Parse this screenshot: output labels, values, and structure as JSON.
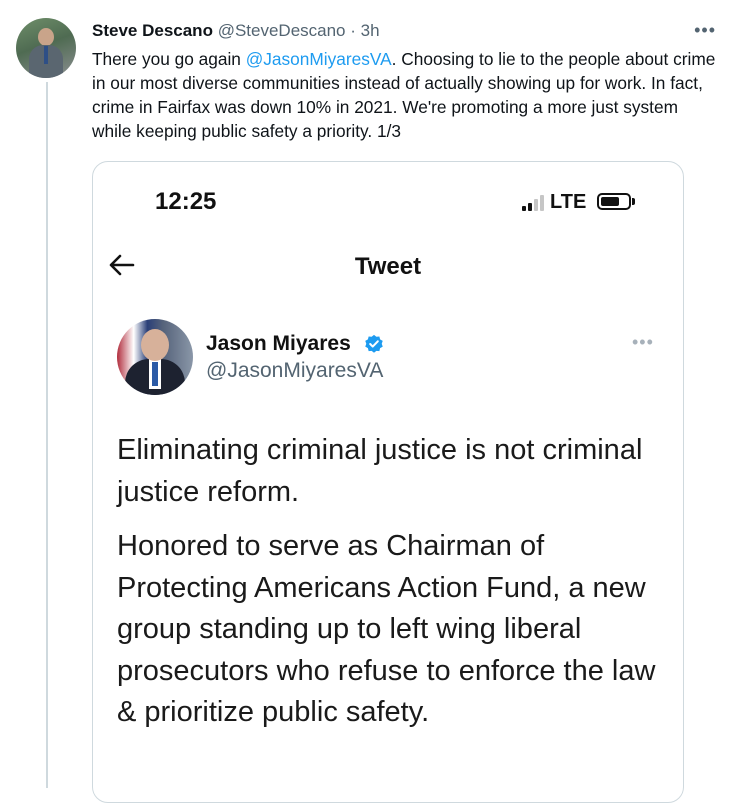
{
  "tweet": {
    "author_name": "Steve Descano",
    "author_handle": "@SteveDescano",
    "separator": "·",
    "time": "3h",
    "more_label": "•••",
    "text_before": "There you go again ",
    "mention": "@JasonMiyaresVA",
    "text_after": ". Choosing to lie to the people about crime in our most diverse communities instead of actually showing up for work. In fact, crime in Fairfax was down 10% in 2021. We're promoting a more just system while keeping public safety a priority. 1/3"
  },
  "embedded_screenshot": {
    "status_time": "12:25",
    "network": "LTE",
    "nav_title": "Tweet",
    "quoted": {
      "author_name": "Jason Miyares",
      "author_handle": "@JasonMiyaresVA",
      "more_label": "•••",
      "paragraph_1": "Eliminating criminal justice is not criminal justice reform.",
      "paragraph_2": "Honored to serve as Chairman of Protecting Americans Action Fund, a new group standing up to left wing liberal prosecutors who refuse to enforce the law & prioritize public safety."
    }
  },
  "colors": {
    "link": "#1d9bf0",
    "secondary_text": "#536471",
    "verified": "#1d9bf0"
  },
  "icons": [
    "more-icon",
    "signal-icon",
    "battery-icon",
    "back-arrow-icon",
    "verified-badge-icon"
  ]
}
